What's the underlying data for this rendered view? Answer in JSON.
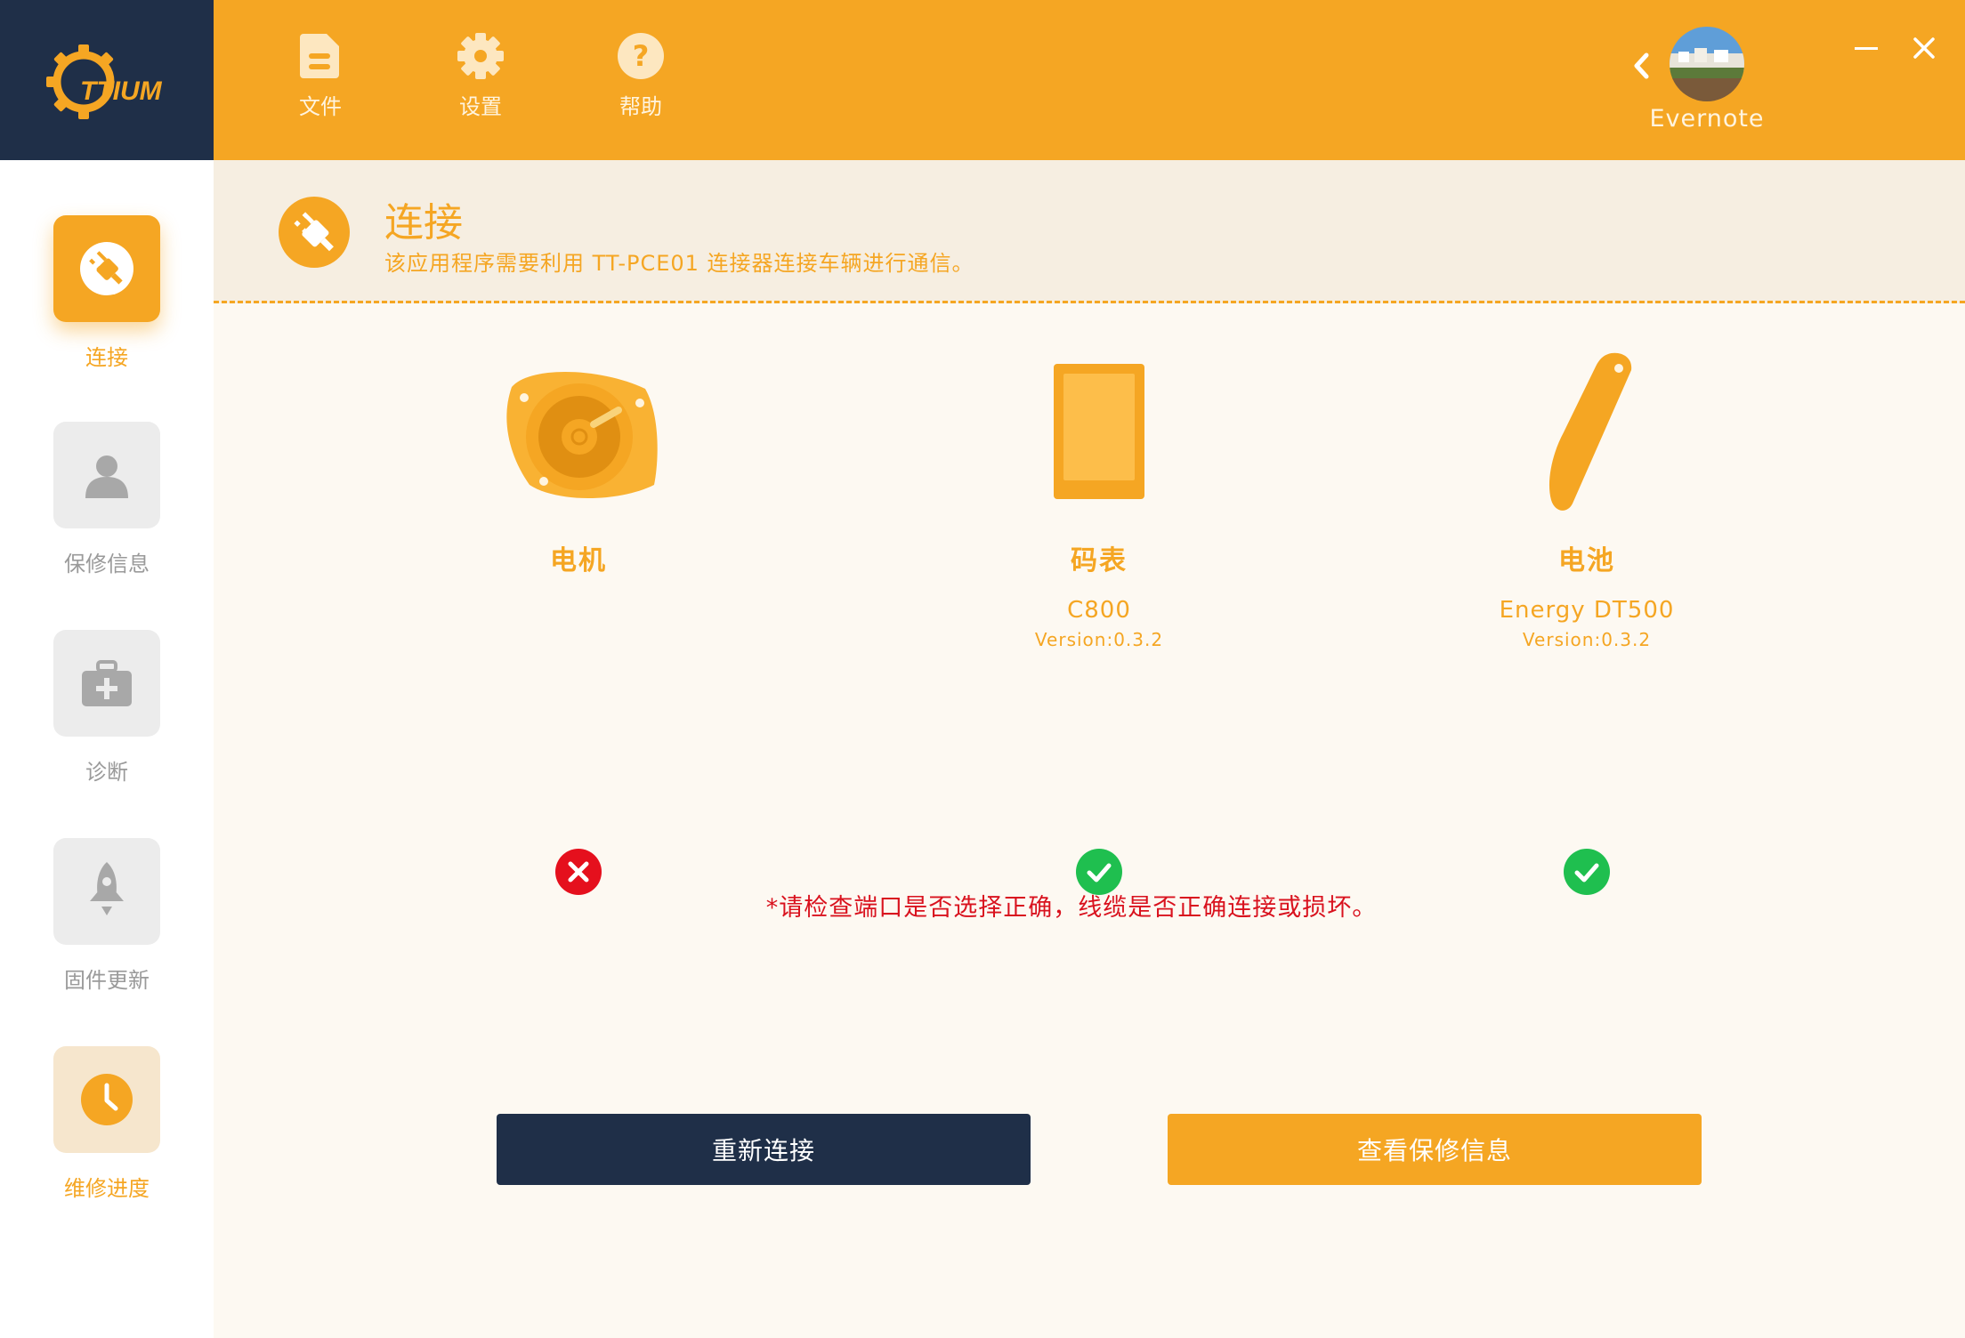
{
  "app": {
    "logo_text": "TTIUM",
    "brand_color": "#f5a623",
    "dark_color": "#1f2f48"
  },
  "topbar": {
    "menu": [
      {
        "label": "文件",
        "icon": "file-icon"
      },
      {
        "label": "设置",
        "icon": "gear-icon"
      },
      {
        "label": "帮助",
        "icon": "help-icon"
      }
    ],
    "user": {
      "name": "Evernote",
      "avatar": "avatar-photo"
    },
    "window_controls": [
      "minimize-icon",
      "close-icon"
    ]
  },
  "sidebar": {
    "items": [
      {
        "label": "连接",
        "icon": "plug-icon",
        "state": "active"
      },
      {
        "label": "保修信息",
        "icon": "user-icon",
        "state": "inactive"
      },
      {
        "label": "诊断",
        "icon": "medkit-icon",
        "state": "inactive"
      },
      {
        "label": "固件更新",
        "icon": "rocket-icon",
        "state": "inactive"
      },
      {
        "label": "维修进度",
        "icon": "clock-icon",
        "state": "highlight"
      }
    ]
  },
  "header": {
    "title": "连接",
    "subtitle": "该应用程序需要利用 TT-PCE01 连接器连接车辆进行通信。",
    "icon": "plug-icon"
  },
  "devices": [
    {
      "name": "电机",
      "model": "",
      "version": "",
      "status": "error",
      "icon": "motor-icon"
    },
    {
      "name": "码表",
      "model": "C800",
      "version": "Version:0.3.2",
      "status": "ok",
      "icon": "display-icon"
    },
    {
      "name": "电池",
      "model": "Energy DT500",
      "version": "Version:0.3.2",
      "status": "ok",
      "icon": "battery-icon"
    }
  ],
  "status_colors": {
    "ok": "#1fbf4f",
    "error": "#e5101d"
  },
  "warning": "*请检查端口是否选择正确，线缆是否正确连接或损坏。",
  "buttons": {
    "reconnect": "重新连接",
    "view_warranty": "查看保修信息"
  }
}
